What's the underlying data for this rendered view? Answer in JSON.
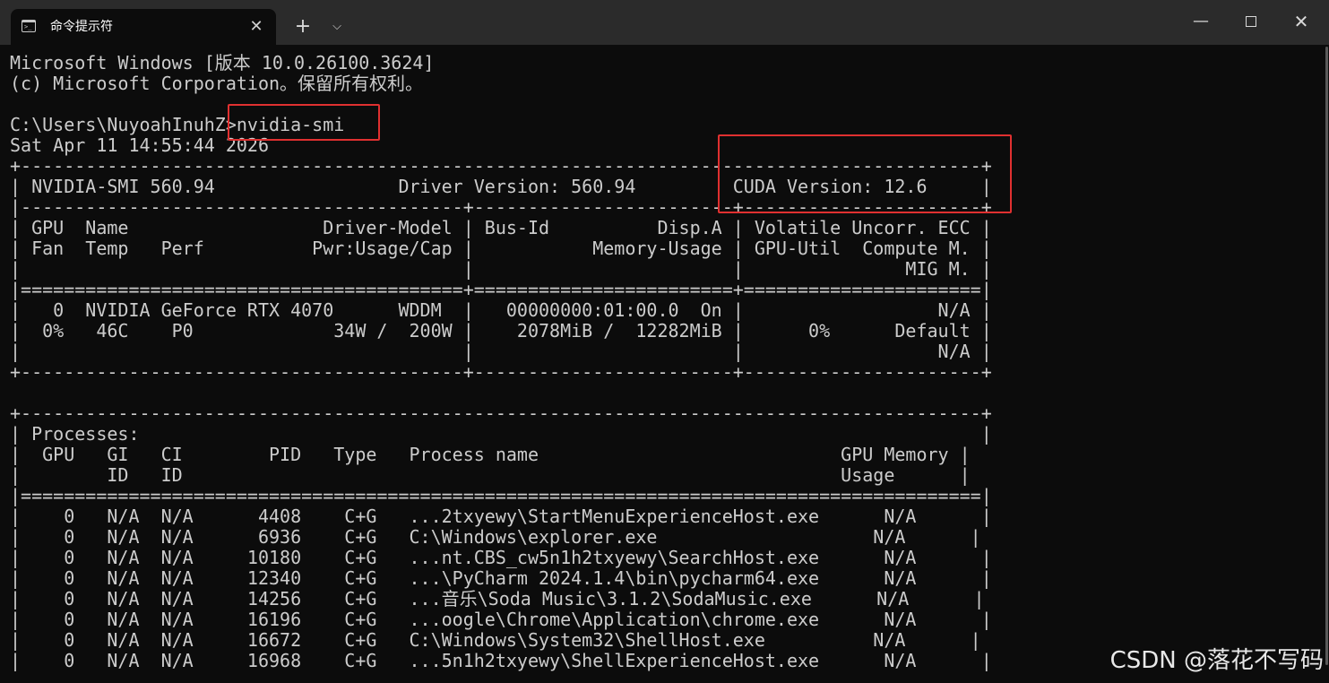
{
  "window": {
    "tab_title": "命令提示符",
    "tab_icon": "cmd-icon",
    "close_tab_glyph": "✕",
    "new_tab_glyph": "+",
    "dropdown_glyph": "⌵",
    "minimize_glyph": "—",
    "close_glyph": "✕"
  },
  "terminal": {
    "lines": [
      "Microsoft Windows [版本 10.0.26100.3624]",
      "(c) Microsoft Corporation。保留所有权利。",
      "",
      "C:\\Users\\NuyoahInuhZ>nvidia-smi",
      "Sat Apr 11 14:55:44 2026",
      "+-----------------------------------------------------------------------------------------+",
      "| NVIDIA-SMI 560.94                 Driver Version: 560.94         CUDA Version: 12.6     |",
      "|-----------------------------------------+------------------------+----------------------+",
      "| GPU  Name                  Driver-Model | Bus-Id          Disp.A | Volatile Uncorr. ECC |",
      "| Fan  Temp   Perf          Pwr:Usage/Cap |           Memory-Usage | GPU-Util  Compute M. |",
      "|                                         |                        |               MIG M. |",
      "|=========================================+========================+======================|",
      "|   0  NVIDIA GeForce RTX 4070      WDDM  |   00000000:01:00.0  On |                  N/A |",
      "|  0%   46C    P0             34W /  200W |    2078MiB /  12282MiB |      0%      Default |",
      "|                                         |                        |                  N/A |",
      "+-----------------------------------------+------------------------+----------------------+",
      "",
      "+-----------------------------------------------------------------------------------------+",
      "| Processes:                                                                              |",
      "|  GPU   GI   CI        PID   Type   Process name                            GPU Memory |",
      "|        ID   ID                                                             Usage      |",
      "|=========================================================================================|",
      "|    0   N/A  N/A      4408    C+G   ...2txyewy\\StartMenuExperienceHost.exe      N/A      |",
      "|    0   N/A  N/A      6936    C+G   C:\\Windows\\explorer.exe                    N/A      |",
      "|    0   N/A  N/A     10180    C+G   ...nt.CBS_cw5n1h2txyewy\\SearchHost.exe      N/A      |",
      "|    0   N/A  N/A     12340    C+G   ...\\PyCharm 2024.1.4\\bin\\pycharm64.exe      N/A      |",
      "|    0   N/A  N/A     14256    C+G   ...音乐\\Soda Music\\3.1.2\\SodaMusic.exe      N/A      |",
      "|    0   N/A  N/A     16196    C+G   ...oogle\\Chrome\\Application\\chrome.exe      N/A      |",
      "|    0   N/A  N/A     16672    C+G   C:\\Windows\\System32\\ShellHost.exe          N/A      |",
      "|    0   N/A  N/A     16968    C+G   ...5n1h2txyewy\\ShellExperienceHost.exe      N/A      |"
    ]
  },
  "watermark": "CSDN @落花不写码",
  "colors": {
    "background": "#0c0c0c",
    "text": "#cccccc",
    "titlebar": "#2b2b2b",
    "highlight": "#e03030"
  }
}
